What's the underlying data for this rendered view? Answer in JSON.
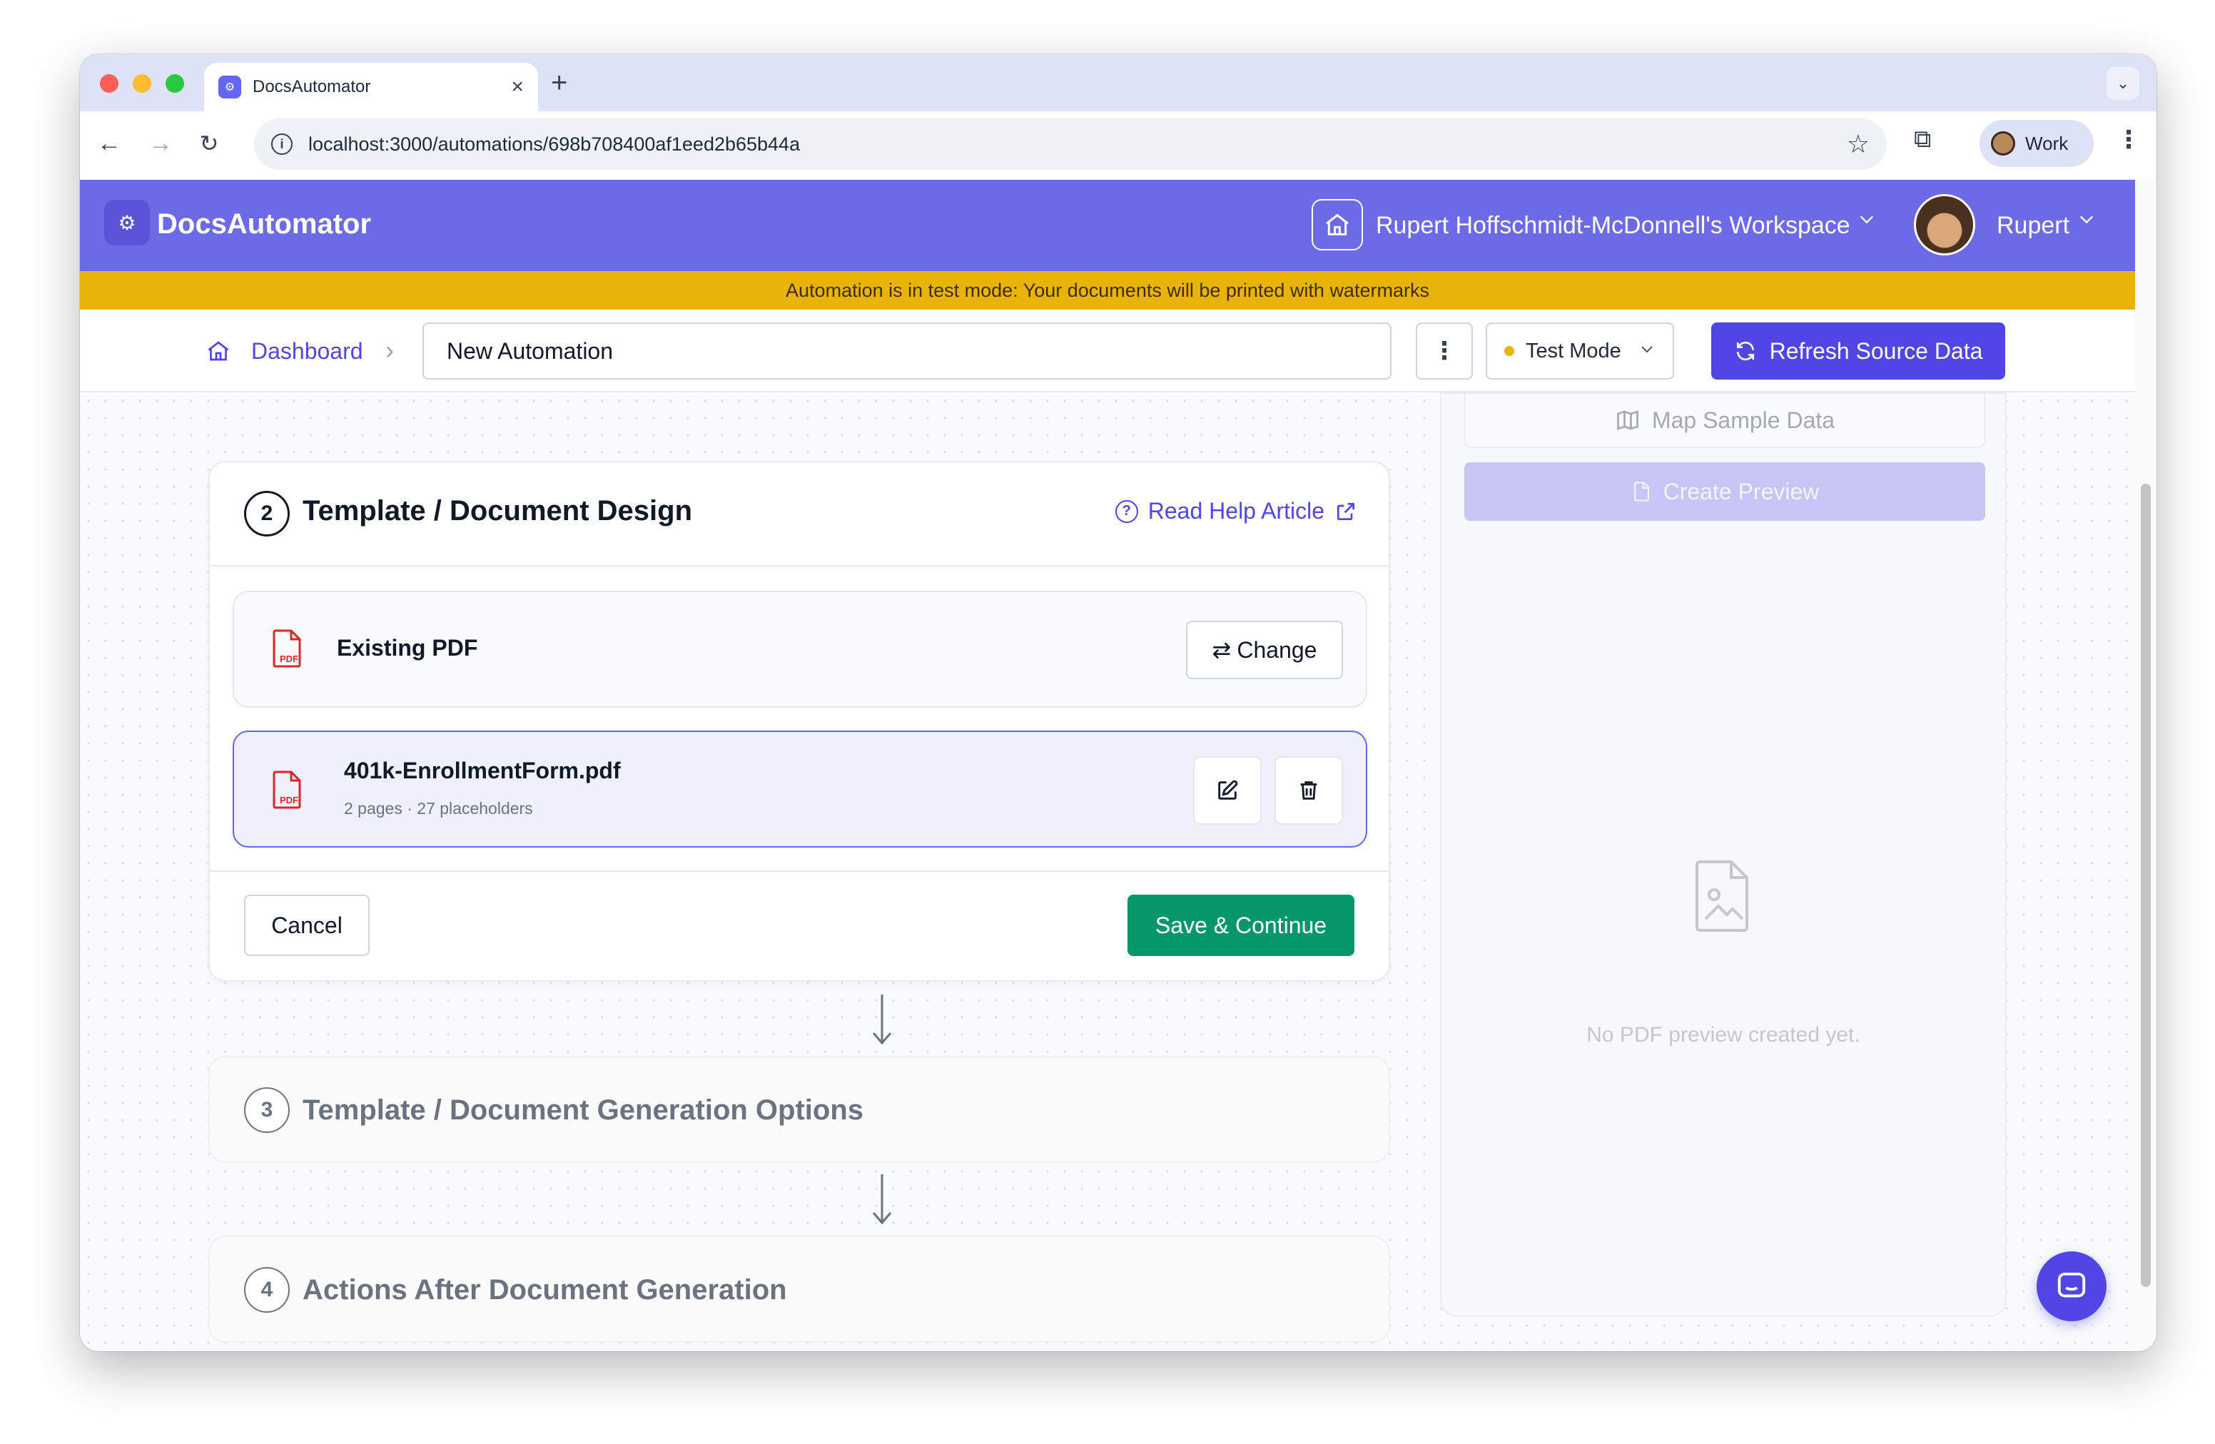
{
  "browser": {
    "tab_title": "DocsAutomator",
    "url": "localhost:3000/automations/698b708400af1eed2b65b44a",
    "profile_label": "Work"
  },
  "header": {
    "app_name": "DocsAutomator",
    "workspace_name": "Rupert Hoffschmidt-McDonnell's Workspace",
    "user_name": "Rupert"
  },
  "banner": {
    "text": "Automation is in test mode: Your documents will be printed with watermarks"
  },
  "subbar": {
    "breadcrumb_home": "Dashboard",
    "automation_name": "New Automation",
    "mode_label": "Test Mode",
    "refresh_label": "Refresh Source Data"
  },
  "step2": {
    "number": "2",
    "title": "Template / Document Design",
    "help_link": "Read Help Article",
    "source_type": "Existing PDF",
    "change_label": "Change",
    "file_name": "401k-EnrollmentForm.pdf",
    "file_meta": "2 pages · 27 placeholders",
    "pdf_badge": "PDF",
    "cancel_label": "Cancel",
    "save_label": "Save & Continue"
  },
  "steps": [
    {
      "number": "3",
      "title": "Template / Document Generation Options"
    },
    {
      "number": "4",
      "title": "Actions After Document Generation"
    }
  ],
  "preview": {
    "map_label": "Map Sample Data",
    "create_label": "Create Preview",
    "empty_text": "No PDF preview created yet."
  },
  "colors": {
    "brand": "#6d6ae7",
    "primary": "#4f46e5",
    "banner": "#eab308",
    "success": "#059669",
    "pdf_red": "#dc2626"
  }
}
